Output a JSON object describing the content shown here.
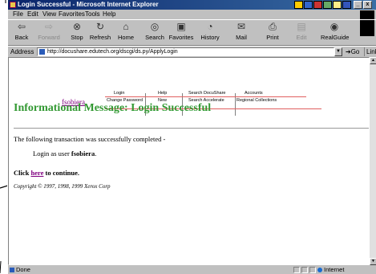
{
  "window": {
    "title": "Login Successful - Microsoft Internet Explorer"
  },
  "menu": {
    "items": [
      "File",
      "Edit",
      "View",
      "Favorites",
      "Tools",
      "Help"
    ]
  },
  "toolbar": {
    "back": "Back",
    "forward": "Forward",
    "stop": "Stop",
    "refresh": "Refresh",
    "home": "Home",
    "search": "Search",
    "favorites": "Favorites",
    "history": "History",
    "mail": "Mail",
    "print": "Print",
    "edit": "Edit",
    "realguide": "RealGuide"
  },
  "address": {
    "label": "Address",
    "url": "http://docushare.edutech.org/dscgi/ds.py/ApplyLogin",
    "go": "Go",
    "links": "Links"
  },
  "site_nav": {
    "user": "fsobiera",
    "login": "Login",
    "change_password": "Change Password",
    "help": "Help",
    "new": "New",
    "search_docushare": "Search DocuShare",
    "search_accelerate": "Search Accelerate",
    "accounts": "Accounts",
    "regional_collections": "Regional Collections"
  },
  "page": {
    "heading": "Informational Message: Login Successful",
    "completed_text": "The following transaction was successfully completed -",
    "logged_prefix": "Login as user ",
    "logged_user": "fsobiera",
    "logged_suffix": ".",
    "click_prefix": "Click ",
    "click_link": "here",
    "click_suffix": " to continue.",
    "copyright": "Copyright © 1997, 1998, 1999 Xerox Corp"
  },
  "status": {
    "text": "Done",
    "zone": "Internet"
  },
  "colors": {
    "heading": "#339933",
    "link_visited": "#800080",
    "nav_rule": "#e06060",
    "titlebar": "#0a246a"
  }
}
